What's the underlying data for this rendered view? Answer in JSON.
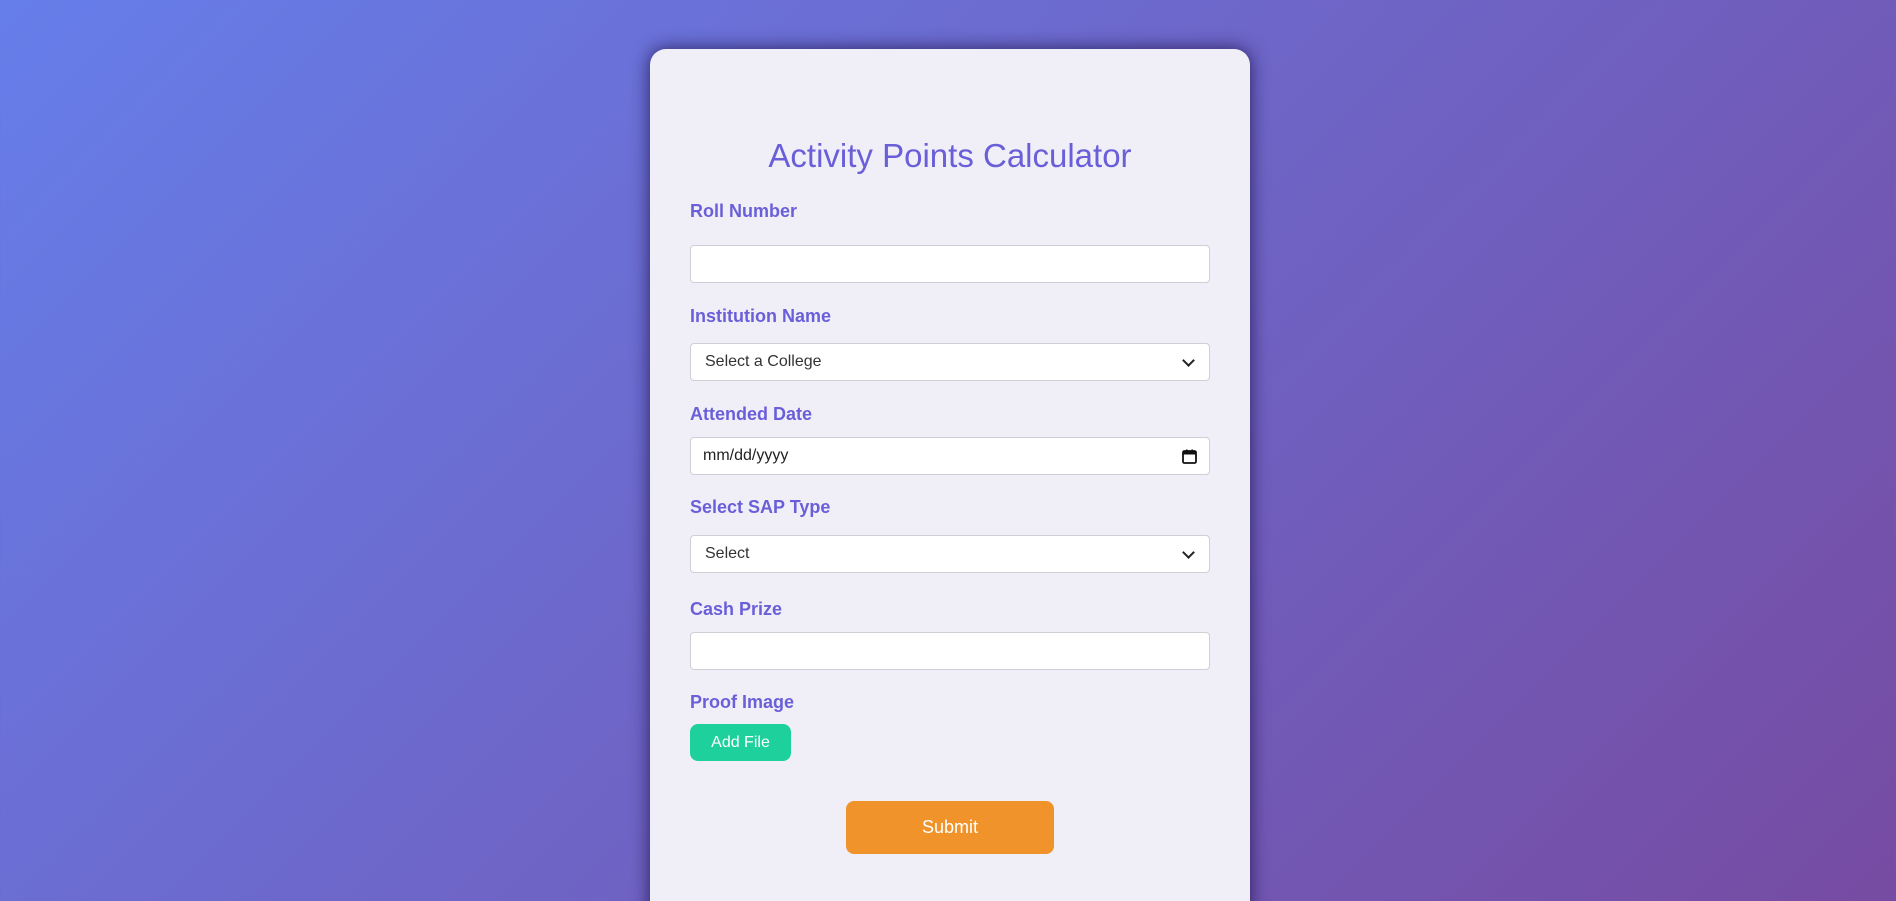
{
  "form": {
    "title": "Activity Points Calculator",
    "roll_number": {
      "label": "Roll Number",
      "value": ""
    },
    "institution": {
      "label": "Institution Name",
      "selected": "Select a College"
    },
    "attended_date": {
      "label": "Attended Date",
      "placeholder": "mm/dd/yyyy"
    },
    "sap_type": {
      "label": "Select SAP Type",
      "selected": "Select"
    },
    "cash_prize": {
      "label": "Cash Prize",
      "value": ""
    },
    "proof_image": {
      "label": "Proof Image",
      "button_label": "Add File"
    },
    "submit_label": "Submit"
  },
  "icons": {
    "select_arrow": "chevron-down-icon",
    "date_picker": "calendar-icon"
  },
  "colors": {
    "background_start": "#667eea",
    "background_end": "#764ba2",
    "card": "#f0eff8",
    "accent_text": "#6a5fd8",
    "add_file_button": "#1ed19c",
    "submit_button": "#f0932b"
  }
}
